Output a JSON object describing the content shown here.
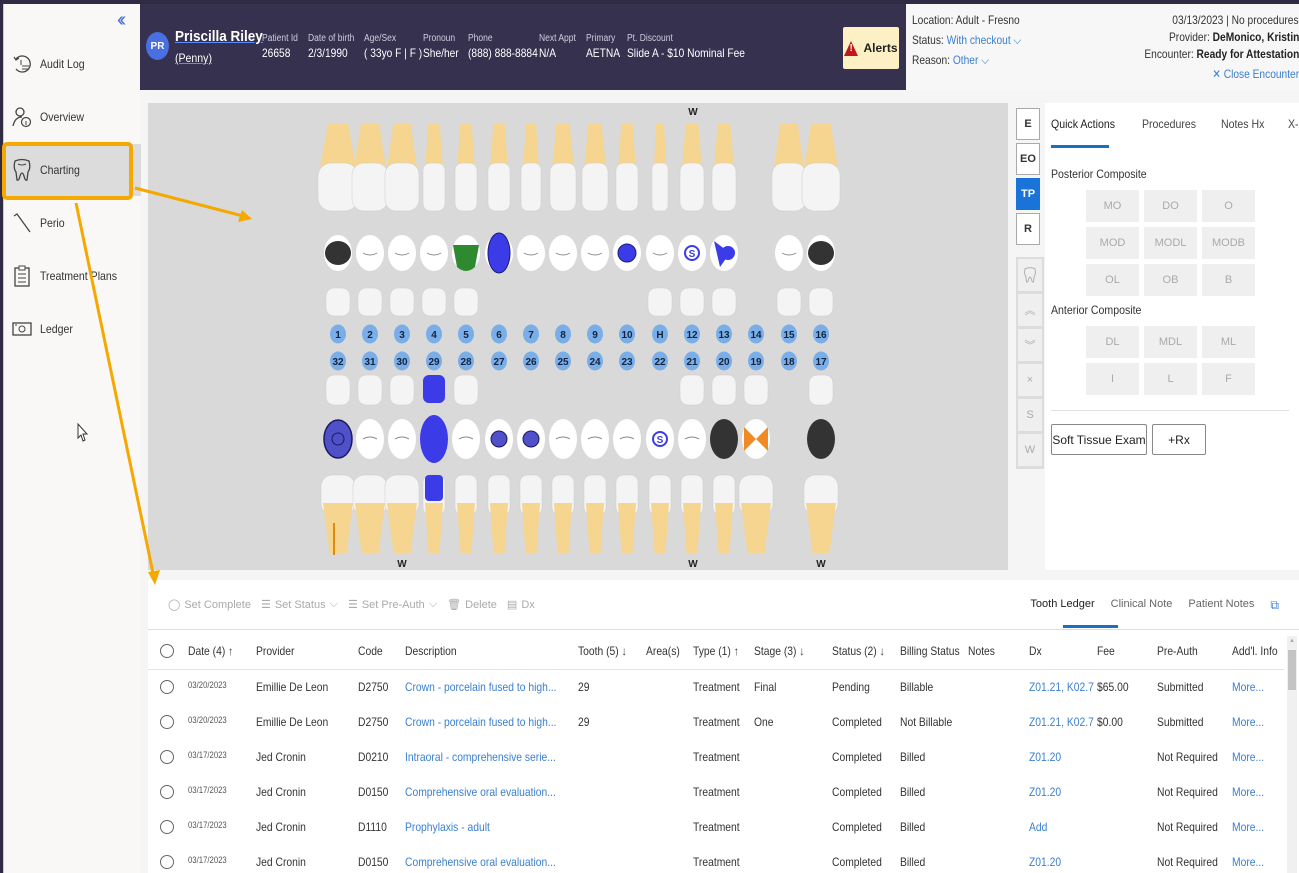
{
  "sidebar": {
    "collapse_icon": "double-chevron-left-icon",
    "items": [
      {
        "label": "Audit Log",
        "icon": "audit-log-icon"
      },
      {
        "label": "Overview",
        "icon": "person-info-icon"
      },
      {
        "label": "Charting",
        "icon": "tooth-icon",
        "active": true
      },
      {
        "label": "Perio",
        "icon": "perio-probe-icon"
      },
      {
        "label": "Treatment Plans",
        "icon": "clipboard-icon"
      },
      {
        "label": "Ledger",
        "icon": "money-icon"
      }
    ]
  },
  "patient": {
    "initials": "PR",
    "name": "Priscilla Riley",
    "nickname": "(Penny)",
    "fields": [
      {
        "label": "Patient Id",
        "value": "26658"
      },
      {
        "label": "Date of birth",
        "value": "2/3/1990"
      },
      {
        "label": "Age/Sex",
        "value": "( 33yo F | F )"
      },
      {
        "label": "Pronoun",
        "value": "She/her"
      },
      {
        "label": "Phone",
        "value": "(888) 888-8884"
      },
      {
        "label": "Next Appt",
        "value": "N/A"
      },
      {
        "label": "Primary",
        "value": "AETNA"
      },
      {
        "label": "Pt. Discount",
        "value": "Slide A - $10 Nominal Fee"
      }
    ],
    "alerts_label": "Alerts"
  },
  "encounter": {
    "location_label": "Location:",
    "location_value": "Adult - Fresno",
    "status_label": "Status:",
    "status_value": "With checkout",
    "reason_label": "Reason:",
    "reason_value": "Other",
    "date_summary": "03/13/2023 | No procedures",
    "provider_label": "Provider:",
    "provider_value": "DeMonico, Kristin",
    "encounter_label": "Encounter:",
    "encounter_value": "Ready for Attestation",
    "close_label": "Close Encounter"
  },
  "chart": {
    "upper_numbers": [
      "1",
      "2",
      "3",
      "4",
      "5",
      "6",
      "7",
      "8",
      "9",
      "10",
      "H",
      "12",
      "13",
      "14",
      "15",
      "16"
    ],
    "lower_numbers": [
      "32",
      "31",
      "30",
      "29",
      "28",
      "27",
      "26",
      "25",
      "24",
      "23",
      "22",
      "21",
      "20",
      "19",
      "18",
      "17"
    ],
    "upper_w_mark": "W",
    "lower_w_marks": [
      "W",
      "W",
      "W"
    ],
    "colors": {
      "treatment": "#3b3be8",
      "existing": "#2f8a2f",
      "missing": "#333333",
      "ortho": "#f08a24",
      "root": "#f5d590"
    }
  },
  "toggles": {
    "view_buttons": [
      "E",
      "EO",
      "TP",
      "R"
    ],
    "active_view": "TP",
    "tools": [
      {
        "icon": "tooth-outline-icon",
        "label": ""
      },
      {
        "icon": "chevrons-up-icon",
        "label": "⌃"
      },
      {
        "icon": "chevrons-down-icon",
        "label": "⌄"
      },
      {
        "icon": "x-icon",
        "label": "×"
      },
      {
        "icon": "s-icon",
        "label": "S"
      },
      {
        "icon": "w-icon",
        "label": "W"
      }
    ]
  },
  "quick_actions": {
    "tabs": [
      "Quick Actions",
      "Procedures",
      "Notes Hx",
      "X-Rays"
    ],
    "active_tab": "Quick Actions",
    "posterior_title": "Posterior Composite",
    "posterior": [
      "MO",
      "DO",
      "O",
      "MOD",
      "MODL",
      "MODB",
      "OL",
      "OB",
      "B"
    ],
    "anterior_title": "Anterior Composite",
    "anterior": [
      "DL",
      "MDL",
      "ML",
      "I",
      "L",
      "F"
    ],
    "soft_tissue_label": "Soft Tissue Exam",
    "rx_label": "+Rx"
  },
  "ledger": {
    "toolbar": [
      {
        "label": "Set Complete",
        "icon": "check-circle-icon"
      },
      {
        "label": "Set Status",
        "icon": "list-icon",
        "dropdown": true
      },
      {
        "label": "Set Pre-Auth",
        "icon": "list-icon",
        "dropdown": true
      },
      {
        "label": "Delete",
        "icon": "trash-icon"
      },
      {
        "label": "Dx",
        "icon": "document-icon"
      }
    ],
    "tabs": [
      "Tooth Ledger",
      "Clinical Note",
      "Patient Notes"
    ],
    "active_tab": "Tooth Ledger",
    "columns": [
      "Date (4) ↑",
      "Provider",
      "Code",
      "Description",
      "Tooth (5) ↓",
      "Area(s)",
      "Type (1) ↑",
      "Stage (3) ↓",
      "Status (2) ↓",
      "Billing Status",
      "Notes",
      "Dx",
      "Fee",
      "Pre-Auth",
      "Add'l. Info"
    ],
    "rows": [
      {
        "date": "03/20/2023",
        "provider": "Emillie De Leon",
        "code": "D2750",
        "description": "Crown - porcelain fused to high...",
        "tooth": "29",
        "areas": "",
        "type": "Treatment",
        "stage": "Final",
        "status": "Pending",
        "billing": "Billable",
        "notes": "",
        "dx": "Z01.21, K02.7",
        "fee": "$65.00",
        "preauth": "Submitted",
        "info": "More..."
      },
      {
        "date": "03/20/2023",
        "provider": "Emillie De Leon",
        "code": "D2750",
        "description": "Crown - porcelain fused to high...",
        "tooth": "29",
        "areas": "",
        "type": "Treatment",
        "stage": "One",
        "status": "Completed",
        "billing": "Not Billable",
        "notes": "",
        "dx": "Z01.21, K02.7",
        "fee": "$0.00",
        "preauth": "Submitted",
        "info": "More..."
      },
      {
        "date": "03/17/2023",
        "provider": "Jed Cronin",
        "code": "D0210",
        "description": "Intraoral - comprehensive serie...",
        "tooth": "",
        "areas": "",
        "type": "Treatment",
        "stage": "",
        "status": "Completed",
        "billing": "Billed",
        "notes": "",
        "dx": "Z01.20",
        "fee": "",
        "preauth": "Not Required",
        "info": "More..."
      },
      {
        "date": "03/17/2023",
        "provider": "Jed Cronin",
        "code": "D0150",
        "description": "Comprehensive oral evaluation...",
        "tooth": "",
        "areas": "",
        "type": "Treatment",
        "stage": "",
        "status": "Completed",
        "billing": "Billed",
        "notes": "",
        "dx": "Z01.20",
        "fee": "",
        "preauth": "Not Required",
        "info": "More..."
      },
      {
        "date": "03/17/2023",
        "provider": "Jed Cronin",
        "code": "D1110",
        "description": "Prophylaxis - adult",
        "tooth": "",
        "areas": "",
        "type": "Treatment",
        "stage": "",
        "status": "Completed",
        "billing": "Billed",
        "notes": "",
        "dx": "Add",
        "fee": "",
        "preauth": "Not Required",
        "info": "More..."
      },
      {
        "date": "03/17/2023",
        "provider": "Jed Cronin",
        "code": "D0150",
        "description": "Comprehensive oral evaluation...",
        "tooth": "",
        "areas": "",
        "type": "Treatment",
        "stage": "",
        "status": "Completed",
        "billing": "Billed",
        "notes": "",
        "dx": "Z01.20",
        "fee": "",
        "preauth": "Not Required",
        "info": "More..."
      }
    ]
  }
}
